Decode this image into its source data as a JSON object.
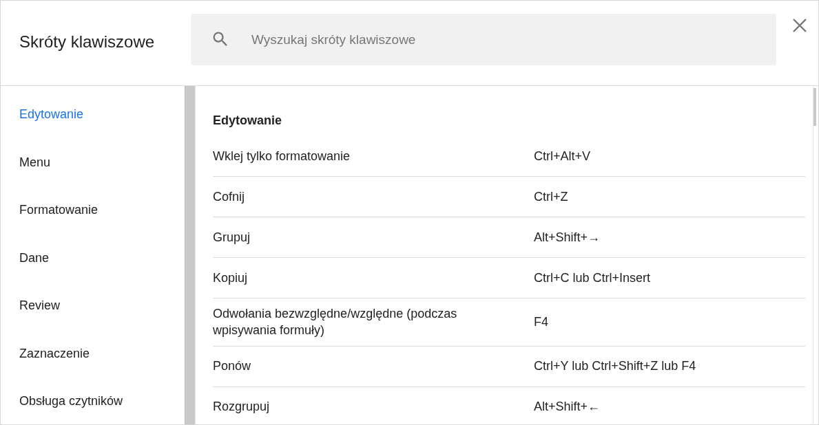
{
  "dialog": {
    "title": "Skróty klawiszowe",
    "search": {
      "placeholder": "Wyszukaj skróty klawiszowe"
    }
  },
  "sidebar": {
    "items": [
      {
        "label": "Edytowanie",
        "selected": true
      },
      {
        "label": "Menu",
        "selected": false
      },
      {
        "label": "Formatowanie",
        "selected": false
      },
      {
        "label": "Dane",
        "selected": false
      },
      {
        "label": "Review",
        "selected": false
      },
      {
        "label": "Zaznaczenie",
        "selected": false
      },
      {
        "label": "Obsługa czytników",
        "selected": false
      }
    ]
  },
  "section": {
    "heading": "Edytowanie",
    "rows": [
      {
        "action": "Wklej tylko formatowanie",
        "shortcut": "Ctrl+Alt+V"
      },
      {
        "action": "Cofnij",
        "shortcut": "Ctrl+Z"
      },
      {
        "action": "Grupuj",
        "shortcut": "Alt+Shift+→"
      },
      {
        "action": "Kopiuj",
        "shortcut": "Ctrl+C lub Ctrl+Insert"
      },
      {
        "action": "Odwołania bezwzględne/względne (podczas wpisywania formuły)",
        "shortcut": "F4"
      },
      {
        "action": "Ponów",
        "shortcut": "Ctrl+Y lub Ctrl+Shift+Z lub F4"
      },
      {
        "action": "Rozgrupuj",
        "shortcut": "Alt+Shift+←"
      }
    ]
  }
}
